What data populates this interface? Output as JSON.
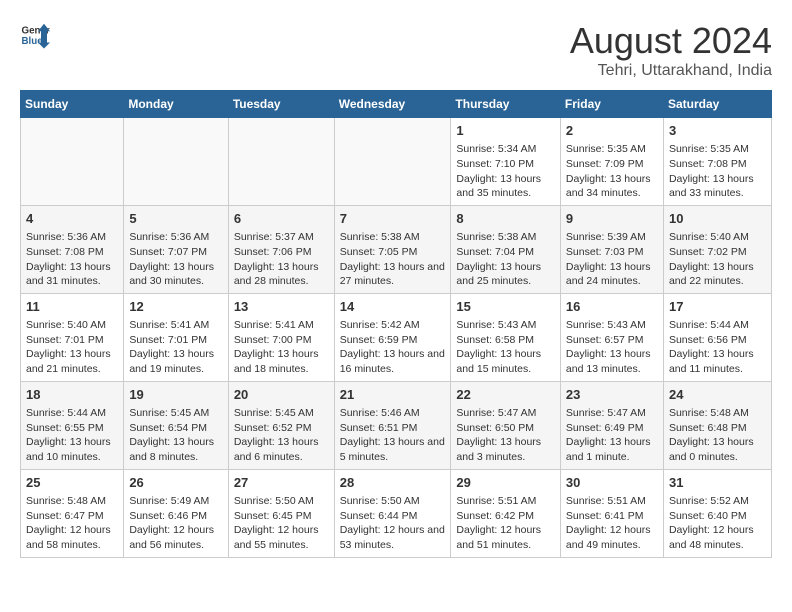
{
  "logo": {
    "general": "General",
    "blue": "Blue"
  },
  "title": "August 2024",
  "subtitle": "Tehri, Uttarakhand, India",
  "days_of_week": [
    "Sunday",
    "Monday",
    "Tuesday",
    "Wednesday",
    "Thursday",
    "Friday",
    "Saturday"
  ],
  "weeks": [
    {
      "cells": [
        {
          "day": "",
          "content": ""
        },
        {
          "day": "",
          "content": ""
        },
        {
          "day": "",
          "content": ""
        },
        {
          "day": "",
          "content": ""
        },
        {
          "day": "1",
          "content": "Sunrise: 5:34 AM\nSunset: 7:10 PM\nDaylight: 13 hours and 35 minutes."
        },
        {
          "day": "2",
          "content": "Sunrise: 5:35 AM\nSunset: 7:09 PM\nDaylight: 13 hours and 34 minutes."
        },
        {
          "day": "3",
          "content": "Sunrise: 5:35 AM\nSunset: 7:08 PM\nDaylight: 13 hours and 33 minutes."
        }
      ]
    },
    {
      "cells": [
        {
          "day": "4",
          "content": "Sunrise: 5:36 AM\nSunset: 7:08 PM\nDaylight: 13 hours and 31 minutes."
        },
        {
          "day": "5",
          "content": "Sunrise: 5:36 AM\nSunset: 7:07 PM\nDaylight: 13 hours and 30 minutes."
        },
        {
          "day": "6",
          "content": "Sunrise: 5:37 AM\nSunset: 7:06 PM\nDaylight: 13 hours and 28 minutes."
        },
        {
          "day": "7",
          "content": "Sunrise: 5:38 AM\nSunset: 7:05 PM\nDaylight: 13 hours and 27 minutes."
        },
        {
          "day": "8",
          "content": "Sunrise: 5:38 AM\nSunset: 7:04 PM\nDaylight: 13 hours and 25 minutes."
        },
        {
          "day": "9",
          "content": "Sunrise: 5:39 AM\nSunset: 7:03 PM\nDaylight: 13 hours and 24 minutes."
        },
        {
          "day": "10",
          "content": "Sunrise: 5:40 AM\nSunset: 7:02 PM\nDaylight: 13 hours and 22 minutes."
        }
      ]
    },
    {
      "cells": [
        {
          "day": "11",
          "content": "Sunrise: 5:40 AM\nSunset: 7:01 PM\nDaylight: 13 hours and 21 minutes."
        },
        {
          "day": "12",
          "content": "Sunrise: 5:41 AM\nSunset: 7:01 PM\nDaylight: 13 hours and 19 minutes."
        },
        {
          "day": "13",
          "content": "Sunrise: 5:41 AM\nSunset: 7:00 PM\nDaylight: 13 hours and 18 minutes."
        },
        {
          "day": "14",
          "content": "Sunrise: 5:42 AM\nSunset: 6:59 PM\nDaylight: 13 hours and 16 minutes."
        },
        {
          "day": "15",
          "content": "Sunrise: 5:43 AM\nSunset: 6:58 PM\nDaylight: 13 hours and 15 minutes."
        },
        {
          "day": "16",
          "content": "Sunrise: 5:43 AM\nSunset: 6:57 PM\nDaylight: 13 hours and 13 minutes."
        },
        {
          "day": "17",
          "content": "Sunrise: 5:44 AM\nSunset: 6:56 PM\nDaylight: 13 hours and 11 minutes."
        }
      ]
    },
    {
      "cells": [
        {
          "day": "18",
          "content": "Sunrise: 5:44 AM\nSunset: 6:55 PM\nDaylight: 13 hours and 10 minutes."
        },
        {
          "day": "19",
          "content": "Sunrise: 5:45 AM\nSunset: 6:54 PM\nDaylight: 13 hours and 8 minutes."
        },
        {
          "day": "20",
          "content": "Sunrise: 5:45 AM\nSunset: 6:52 PM\nDaylight: 13 hours and 6 minutes."
        },
        {
          "day": "21",
          "content": "Sunrise: 5:46 AM\nSunset: 6:51 PM\nDaylight: 13 hours and 5 minutes."
        },
        {
          "day": "22",
          "content": "Sunrise: 5:47 AM\nSunset: 6:50 PM\nDaylight: 13 hours and 3 minutes."
        },
        {
          "day": "23",
          "content": "Sunrise: 5:47 AM\nSunset: 6:49 PM\nDaylight: 13 hours and 1 minute."
        },
        {
          "day": "24",
          "content": "Sunrise: 5:48 AM\nSunset: 6:48 PM\nDaylight: 13 hours and 0 minutes."
        }
      ]
    },
    {
      "cells": [
        {
          "day": "25",
          "content": "Sunrise: 5:48 AM\nSunset: 6:47 PM\nDaylight: 12 hours and 58 minutes."
        },
        {
          "day": "26",
          "content": "Sunrise: 5:49 AM\nSunset: 6:46 PM\nDaylight: 12 hours and 56 minutes."
        },
        {
          "day": "27",
          "content": "Sunrise: 5:50 AM\nSunset: 6:45 PM\nDaylight: 12 hours and 55 minutes."
        },
        {
          "day": "28",
          "content": "Sunrise: 5:50 AM\nSunset: 6:44 PM\nDaylight: 12 hours and 53 minutes."
        },
        {
          "day": "29",
          "content": "Sunrise: 5:51 AM\nSunset: 6:42 PM\nDaylight: 12 hours and 51 minutes."
        },
        {
          "day": "30",
          "content": "Sunrise: 5:51 AM\nSunset: 6:41 PM\nDaylight: 12 hours and 49 minutes."
        },
        {
          "day": "31",
          "content": "Sunrise: 5:52 AM\nSunset: 6:40 PM\nDaylight: 12 hours and 48 minutes."
        }
      ]
    }
  ]
}
